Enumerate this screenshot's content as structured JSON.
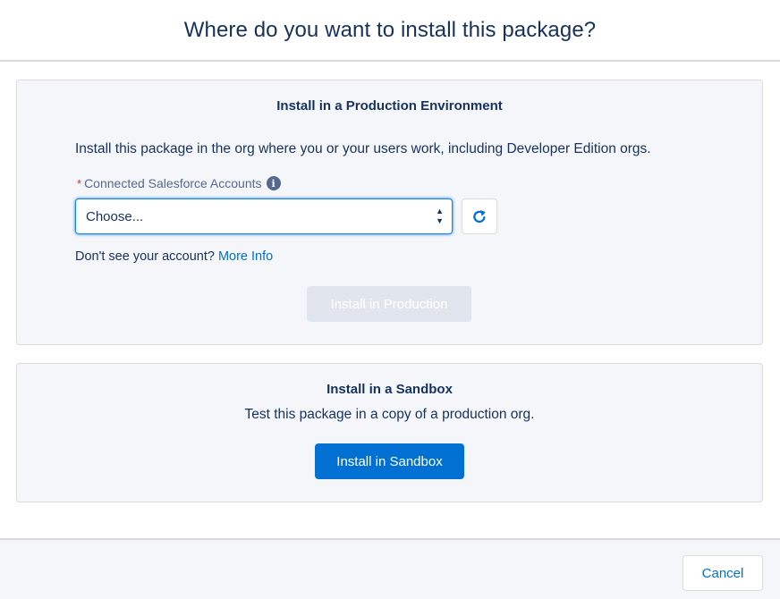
{
  "header": {
    "title": "Where do you want to install this package?"
  },
  "production": {
    "title": "Install in a Production Environment",
    "description": "Install this package in the org where you or your users work, including Developer Edition orgs.",
    "field_required_mark": "*",
    "field_label": "Connected Salesforce Accounts",
    "info_icon_glyph": "i",
    "select_value": "Choose...",
    "account_help_text": "Don't see your account?",
    "more_info_link": "More Info",
    "install_button": "Install in Production",
    "install_button_state": "disabled"
  },
  "sandbox": {
    "title": "Install in a Sandbox",
    "description": "Test this package in a copy of a production org.",
    "install_button": "Install in Sandbox"
  },
  "footer": {
    "cancel_button": "Cancel"
  },
  "icons": {
    "info": "info-icon",
    "refresh": "refresh-icon",
    "select_arrows": "select-arrows-icon"
  },
  "colors": {
    "brand": "#0070d2",
    "text": "#16325c",
    "muted": "#54698d",
    "required": "#c23934",
    "card_bg": "#f4f6f9",
    "border": "#dddbda",
    "disabled_bg": "#e0e5ee"
  }
}
